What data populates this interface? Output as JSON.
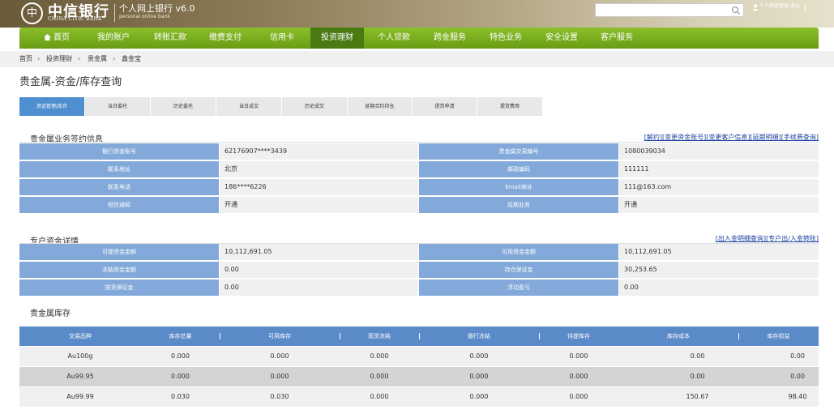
{
  "header": {
    "logo_mark": "中",
    "bank_cn": "中信银行",
    "bank_en": "CHINA CITIC BANK",
    "system_name": "个人网上银行 v6.0",
    "system_sub": "personal online bank",
    "user_text": "个人网银管理 退出",
    "search_placeholder": ""
  },
  "nav": {
    "items": [
      "首页",
      "我的账户",
      "转账汇款",
      "缴费支付",
      "信用卡",
      "投资理财",
      "个人贷款",
      "跨金服务",
      "特色业务",
      "安全设置",
      "客户服务"
    ],
    "active_index": 5
  },
  "breadcrumb": [
    "首页",
    "投资理财",
    "贵金属",
    "鑫金宝"
  ],
  "page_title": "贵金属-资金/库存查询",
  "tabs": [
    "资金管理/库存",
    "当日委托",
    "历史委托",
    "当日成交",
    "历史成交",
    "延期合约持仓",
    "提货申请",
    "提货费用"
  ],
  "signing": {
    "title": "贵金属业务签约信息",
    "links": "[解约][变更资金账号][变更客户信息][延期明细][手续费查询]",
    "rows": [
      {
        "l1": "银行资金账号",
        "v1": "62176907****3439",
        "l2": "贵金属交易编号",
        "v2": "1080039034"
      },
      {
        "l1": "联系地址",
        "v1": "北京",
        "l2": "邮政编码",
        "v2": "111111"
      },
      {
        "l1": "联系电话",
        "v1": "186****6226",
        "l2": "Email地址",
        "v2": "111@163.com"
      },
      {
        "l1": "短信通知",
        "v1": "开通",
        "l2": "延期业务",
        "v2": "开通"
      }
    ]
  },
  "funds": {
    "title": "专户资金详情",
    "links": "[出入金明细查询][专户出/入金转账]",
    "rows": [
      {
        "l1": "可提资金金额",
        "v1": "10,112,691.05",
        "l2": "可用资金金额",
        "v2": "10,112,691.05"
      },
      {
        "l1": "冻结资金金额",
        "v1": "0.00",
        "l2": "持仓保证金",
        "v2": "30,253.65"
      },
      {
        "l1": "提货保证金",
        "v1": "0.00",
        "l2": "浮动盈亏",
        "v2": "0.00"
      }
    ]
  },
  "inventory": {
    "title": "贵金属库存",
    "columns": [
      "交易品种",
      "库存总量",
      "可用库存",
      "现货冻结",
      "银行冻结",
      "待提库存",
      "库存成本",
      "库存损益"
    ],
    "rows": [
      [
        "Au100g",
        "0.000",
        "0.000",
        "0.000",
        "0.000",
        "0.000",
        "0.00",
        "0.00"
      ],
      [
        "Au99.95",
        "0.000",
        "0.000",
        "0.000",
        "0.000",
        "0.000",
        "0.00",
        "0.00"
      ],
      [
        "Au99.99",
        "0.030",
        "0.030",
        "0.000",
        "0.000",
        "0.000",
        "150.67",
        "98.40"
      ]
    ],
    "row_colors": [
      "#f0f0f0",
      "#d4d4d4",
      "#f0f0f0"
    ]
  },
  "colors": {
    "nav_green": "#7aaf1f",
    "label_blue": "#82a9d9",
    "header_blue": "#5a8ac8",
    "link_blue": "#1a3fa0"
  }
}
